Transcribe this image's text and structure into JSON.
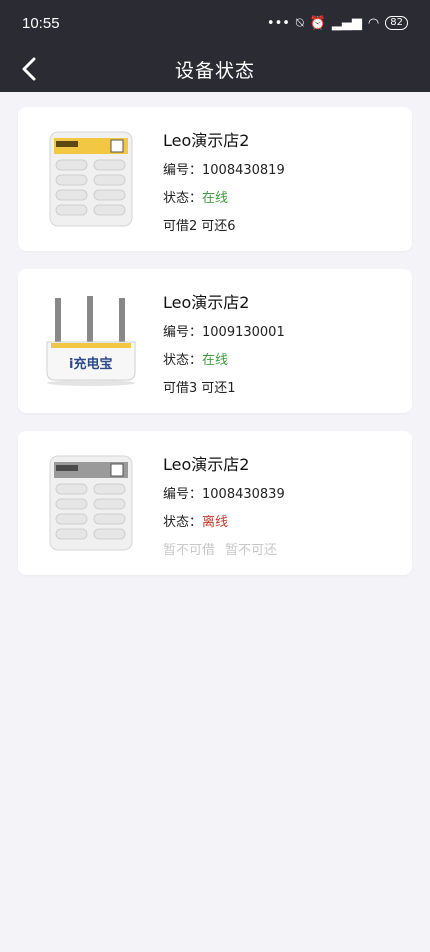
{
  "status_bar": {
    "time": "10:55",
    "battery": "82"
  },
  "header": {
    "title": "设备状态"
  },
  "devices": [
    {
      "name": "Leo演示店2",
      "id_label": "编号：",
      "id": "1008430819",
      "status_label": "状态：",
      "status": "在线",
      "borrow": "可借2",
      "return": "可还6",
      "image": "cabinet-yellow-icon"
    },
    {
      "name": "Leo演示店2",
      "id_label": "编号：",
      "id": "1009130001",
      "status_label": "状态：",
      "status": "在线",
      "borrow": "可借3",
      "return": "可还1",
      "image": "router-charger-icon",
      "brand_text": "i充电宝"
    },
    {
      "name": "Leo演示店2",
      "id_label": "编号：",
      "id": "1008430839",
      "status_label": "状态：",
      "status": "离线",
      "borrow": "暂不可借",
      "return": "暂不可还",
      "image": "cabinet-gray-icon"
    }
  ]
}
